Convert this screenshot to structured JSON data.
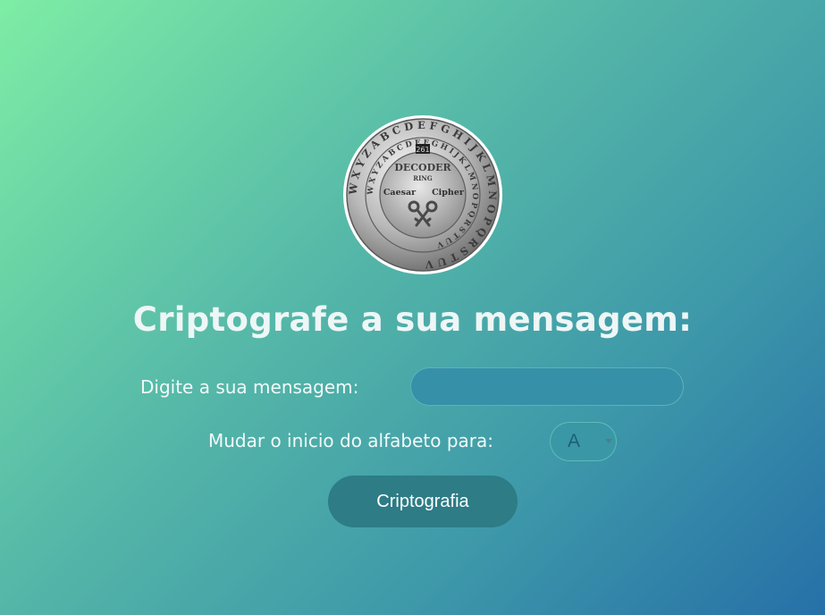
{
  "logo": {
    "icon": "caesar-cipher-decoder-ring-icon",
    "outer_ring_text": "WXYZABCDEFGHIJKLMNOPQRSTUV",
    "inner_ring_text": "WXYZABCDEFGHIJKLMNOPQRSTUV",
    "center_line_1": "DECODER",
    "center_line_2": "RING",
    "center_left": "Caesar",
    "center_right": "Cipher",
    "badge": "261"
  },
  "heading": "Criptografe a sua mensagem:",
  "form": {
    "message_label": "Digite a sua mensagem:",
    "message_value": "",
    "shift_label": "Mudar o inicio do alfabeto para:",
    "shift_selected": "A",
    "submit_label": "Criptografia"
  },
  "colors": {
    "gradient_start": "#7eeda5",
    "gradient_end": "#2670a8",
    "button_bg": "#2d7c86",
    "input_bg": "#3690a8"
  }
}
